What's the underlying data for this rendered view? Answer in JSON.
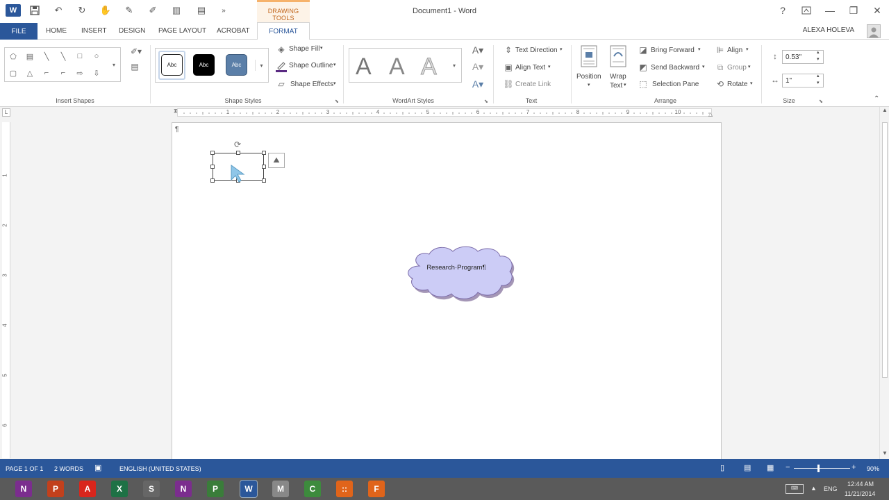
{
  "window": {
    "title": "Document1 - Word",
    "context_tab_group": "DRAWING TOOLS",
    "user_name": "ALEXA HOLEVA",
    "help": "?"
  },
  "tabs": {
    "file": "FILE",
    "items": [
      "HOME",
      "INSERT",
      "DESIGN",
      "PAGE LAYOUT",
      "ACROBAT"
    ],
    "active": "FORMAT"
  },
  "ribbon": {
    "insert_shapes": {
      "label": "Insert Shapes"
    },
    "shape_styles": {
      "label": "Shape Styles",
      "presets": [
        "Abc",
        "Abc",
        "Abc"
      ],
      "shape_fill": "Shape Fill",
      "shape_outline": "Shape Outline",
      "shape_effects": "Shape Effects"
    },
    "wordart": {
      "label": "WordArt Styles",
      "preview": [
        "A",
        "A",
        "A"
      ]
    },
    "text": {
      "label": "Text",
      "text_direction": "Text Direction",
      "align_text": "Align Text",
      "create_link": "Create Link"
    },
    "arrange": {
      "label": "Arrange",
      "position": "Position",
      "wrap_text_1": "Wrap",
      "wrap_text_2": "Text",
      "bring_forward": "Bring Forward",
      "send_backward": "Send Backward",
      "selection_pane": "Selection Pane",
      "align": "Align",
      "group": "Group",
      "rotate": "Rotate"
    },
    "size": {
      "label": "Size",
      "height": "0.53\"",
      "width": "1\""
    }
  },
  "ruler": {
    "h_numbers": [
      "1",
      "2",
      "3",
      "4",
      "5",
      "6",
      "7",
      "8",
      "9",
      "10"
    ],
    "v_numbers": [
      "1",
      "2",
      "3",
      "4",
      "5",
      "6"
    ]
  },
  "document": {
    "cloud_text": "Research·Program¶",
    "para_mark": "¶"
  },
  "status": {
    "page": "PAGE 1 OF 1",
    "words": "2 WORDS",
    "language": "ENGLISH (UNITED STATES)",
    "zoom": "90%"
  },
  "taskbar": {
    "apps": [
      {
        "name": "onenote",
        "label": "N",
        "color": "#7b2d8e"
      },
      {
        "name": "powerpoint",
        "label": "P",
        "color": "#c2401c"
      },
      {
        "name": "acrobat",
        "label": "A",
        "color": "#d9261c"
      },
      {
        "name": "excel",
        "label": "X",
        "color": "#1e7145"
      },
      {
        "name": "scanner",
        "label": "S",
        "color": "#666666"
      },
      {
        "name": "onenote-2",
        "label": "N",
        "color": "#7b2d8e"
      },
      {
        "name": "project",
        "label": "P",
        "color": "#3a7d3a"
      },
      {
        "name": "word",
        "label": "W",
        "color": "#2b579a"
      },
      {
        "name": "media",
        "label": "M",
        "color": "#888888"
      },
      {
        "name": "chrome",
        "label": "C",
        "color": "#3d8b3d"
      },
      {
        "name": "apps-grid",
        "label": "::",
        "color": "#e0641a"
      },
      {
        "name": "firefox",
        "label": "F",
        "color": "#e0641a"
      }
    ],
    "lang": "ENG",
    "time": "12:44 AM",
    "date": "11/21/2014"
  }
}
